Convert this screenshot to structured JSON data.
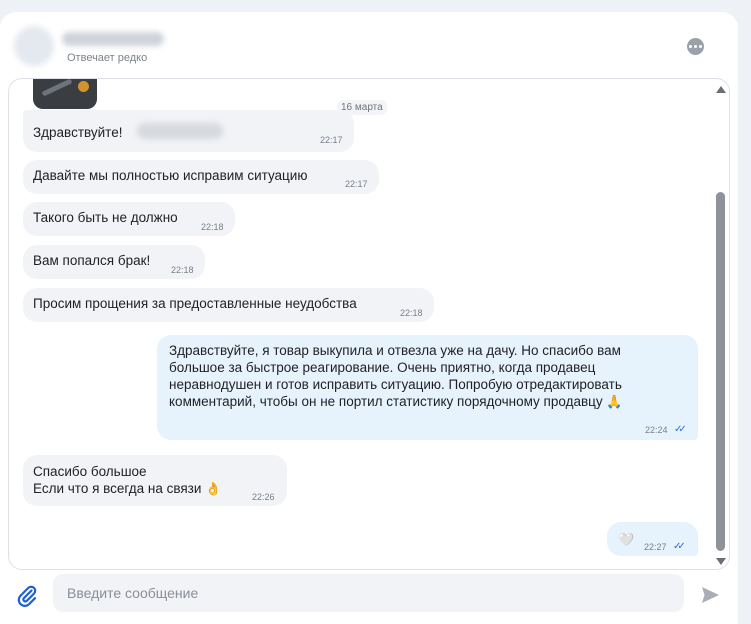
{
  "header": {
    "status": "Отвечает редко",
    "menu_icon": "more-dots-icon"
  },
  "chat": {
    "date_separator": "16 марта",
    "messages": [
      {
        "direction": "in",
        "text": "Здравствуйте!",
        "time": "22:17"
      },
      {
        "direction": "in",
        "text": "Давайте мы полностью исправим ситуацию",
        "time": "22:17"
      },
      {
        "direction": "in",
        "text": "Такого быть не должно",
        "time": "22:18"
      },
      {
        "direction": "in",
        "text": "Вам попался брак!",
        "time": "22:18"
      },
      {
        "direction": "in",
        "text": "Просим прощения за предоставленные неудобства",
        "time": "22:18"
      },
      {
        "direction": "out",
        "text": "Здравствуйте, я товар выкупила и отвезла уже на дачу. Но спасибо вам большое за быстрое реагирование. Очень приятно, когда продавец неравнодушен и готов исправить ситуацию. Попробую отредактировать комментарий, чтобы он не портил статистику порядочному продавцу",
        "emoji": "🙏",
        "time": "22:24",
        "status": "read"
      },
      {
        "direction": "in",
        "line1": "Спасибо большое",
        "line2": "Если что я всегда на связи",
        "emoji": "👌",
        "time": "22:26"
      },
      {
        "direction": "out",
        "emoji": "🤍",
        "time": "22:27",
        "status": "read"
      }
    ]
  },
  "composer": {
    "placeholder": "Введите сообщение",
    "attach_icon": "paperclip-icon",
    "send_icon": "send-arrow-icon"
  },
  "colors": {
    "incoming_bubble": "#f1f3f6",
    "outgoing_bubble": "#e6f3fc",
    "read_ticks": "#2e6fd6",
    "accent": "#1f5fd1"
  }
}
